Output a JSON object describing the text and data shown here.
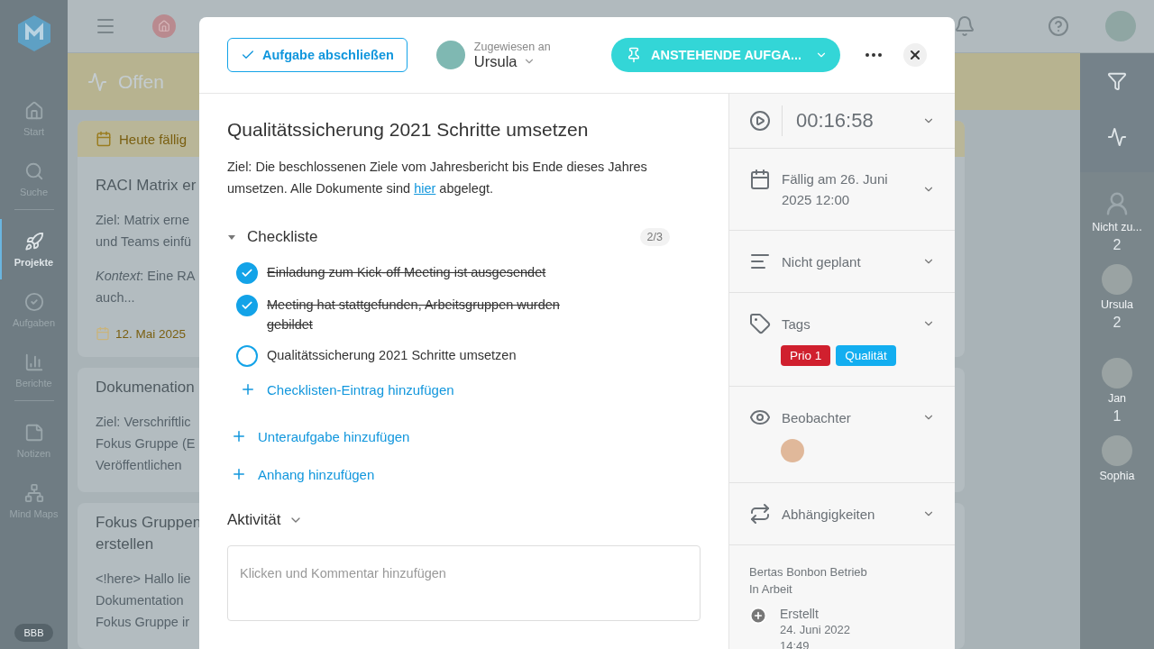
{
  "nav": {
    "items": [
      {
        "kind": "home",
        "label": "Start",
        "selected": false
      },
      {
        "kind": "search",
        "label": "Suche",
        "selected": false
      },
      {
        "kind": "rocket",
        "label": "Projekte",
        "selected": true
      },
      {
        "kind": "check",
        "label": "Aufgaben",
        "selected": false
      },
      {
        "kind": "chart",
        "label": "Berichte",
        "selected": false
      },
      {
        "kind": "note",
        "label": "Notizen",
        "selected": false
      },
      {
        "kind": "mindmap",
        "label": "Mind Maps",
        "selected": false
      }
    ],
    "user_badge": "BBB"
  },
  "column": {
    "title": "Offen",
    "group": "Heute fällig",
    "cards": [
      {
        "title": [
          "RACI Matrix er"
        ],
        "paragraphs": [
          [
            "Ziel: Matrix erne",
            "und Teams einfü"
          ],
          [
            "*Kontext*: Eine RA",
            "auch..."
          ]
        ],
        "date": "12. Mai 2025"
      },
      {
        "title": [
          "Dokumenation"
        ],
        "paragraphs": [
          [
            "Ziel: Verschriftlic",
            "Fokus Gruppe (E",
            "Veröffentlichen"
          ]
        ]
      },
      {
        "title": [
          "Fokus Gruppen",
          "erstellen"
        ],
        "paragraphs": [
          [
            "<!here> Hallo lie",
            "Dokumentation",
            "Fokus Gruppe ir"
          ]
        ]
      }
    ]
  },
  "people": [
    {
      "kind": "unassigned",
      "name": "Nicht zu...",
      "count": "2"
    },
    {
      "kind": "person",
      "name": "Ursula",
      "count": "2"
    },
    {
      "kind": "person",
      "name": "Jan",
      "count": "1"
    },
    {
      "kind": "person",
      "name": "Sophia"
    }
  ],
  "task": {
    "complete_button": "Aufgabe abschließen",
    "assignee": {
      "label": "Zugewiesen an",
      "name": "Ursula"
    },
    "status": "ANSTEHENDE AUFGA...",
    "title": "Qualitätssicherung 2021 Schritte umsetzen",
    "description": {
      "before": "Ziel: Die beschlossenen Ziele vom Jahresbericht bis Ende dieses Jahres umsetzen. Alle Dokumente sind ",
      "link": "hier",
      "after": " abgelegt."
    },
    "checklist": {
      "title": "Checkliste",
      "count": "2/3",
      "expanded": true,
      "items": [
        {
          "text": "Einladung zum Kick-off Meeting ist ausgesendet",
          "checked": true
        },
        {
          "text": "Meeting hat stattgefunden, Arbeitsgruppen wurden gebildet",
          "checked": true
        },
        {
          "text": "Qualitätssicherung 2021 Schritte umsetzen",
          "checked": false
        }
      ],
      "add": "Checklisten-Eintrag hinzufügen"
    },
    "actions": [
      "Unteraufgabe hinzufügen",
      "Anhang hinzufügen"
    ],
    "activity": {
      "title": "Aktivität",
      "placeholder": "Klicken und Kommentar hinzufügen"
    },
    "timer": "00:16:58",
    "sections": [
      {
        "kind": "due",
        "text": "Fällig am 26. Juni 2025 12:00"
      },
      {
        "kind": "plan",
        "text": "Nicht geplant"
      },
      {
        "kind": "tags",
        "text": "Tags",
        "tags": [
          {
            "label": "Prio 1",
            "color": "#d0202e"
          },
          {
            "label": "Qualität",
            "color": "#13aef0"
          }
        ]
      },
      {
        "kind": "watchers",
        "text": "Beobachter"
      },
      {
        "kind": "deps",
        "text": "Abhängigkeiten"
      }
    ],
    "project": "Bertas Bonbon Betrieb",
    "project_status": "In Arbeit",
    "history": [
      {
        "label": "Erstellt",
        "date": "24. Juni 2022",
        "time": "14:49"
      }
    ]
  }
}
